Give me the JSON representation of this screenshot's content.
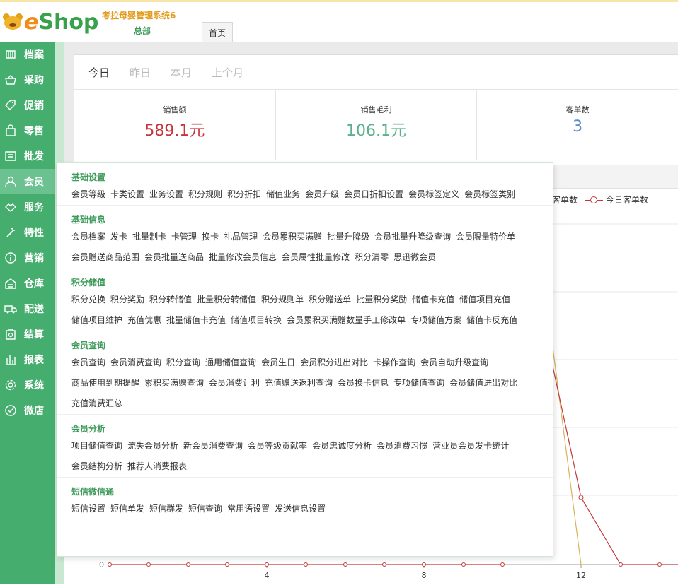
{
  "header": {
    "logo_e": "e",
    "logo_shop": "Shop",
    "system_name": "考拉母婴管理系统6",
    "branch": "总部",
    "tab_home": "首页"
  },
  "sidebar": {
    "items": [
      {
        "label": "档案",
        "icon": "archive-icon"
      },
      {
        "label": "采购",
        "icon": "basket-icon"
      },
      {
        "label": "促销",
        "icon": "tag-icon"
      },
      {
        "label": "零售",
        "icon": "shopping-bag-icon"
      },
      {
        "label": "批发",
        "icon": "wholesale-icon"
      },
      {
        "label": "会员",
        "icon": "user-icon"
      },
      {
        "label": "服务",
        "icon": "handshake-icon"
      },
      {
        "label": "特性",
        "icon": "magic-wand-icon"
      },
      {
        "label": "营销",
        "icon": "info-circle-icon"
      },
      {
        "label": "仓库",
        "icon": "warehouse-icon"
      },
      {
        "label": "配送",
        "icon": "truck-icon"
      },
      {
        "label": "结算",
        "icon": "cash-register-icon"
      },
      {
        "label": "报表",
        "icon": "bar-chart-icon"
      },
      {
        "label": "系统",
        "icon": "gear-icon"
      },
      {
        "label": "微店",
        "icon": "store-icon"
      }
    ],
    "active_index": 5
  },
  "dashboard": {
    "period_tabs": [
      "今日",
      "昨日",
      "本月",
      "上个月"
    ],
    "active_period": 0,
    "stats": [
      {
        "label": "销售额",
        "value": "589.1元",
        "color": "#c8343c"
      },
      {
        "label": "销售毛利",
        "value": "106.1元",
        "color": "#5ab08a"
      },
      {
        "label": "客单数",
        "value": "3",
        "color": "#5b8ec9"
      }
    ],
    "legend": {
      "left_label": "客单数",
      "right_label": "今日客单数"
    }
  },
  "chart_data": {
    "type": "line",
    "x_ticks": [
      "4",
      "8",
      "12"
    ],
    "y_ticks": [
      "0"
    ],
    "series": [
      {
        "name": "今日客单数",
        "color": "#c1393a"
      }
    ],
    "colors": {
      "secondary_line": "#d9b35a",
      "gridline": "#e8e8e8"
    }
  },
  "mega_menu": {
    "sections": [
      {
        "title": "基础设置",
        "items": [
          "会员等级",
          "卡类设置",
          "业务设置",
          "积分规则",
          "积分折扣",
          "储值业务",
          "会员升级",
          "会员日折扣设置",
          "会员标签定义",
          "会员标签类别"
        ]
      },
      {
        "title": "基础信息",
        "items": [
          "会员档案",
          "发卡",
          "批量制卡",
          "卡管理",
          "换卡",
          "礼品管理",
          "会员累积买满赠",
          "批量升降级",
          "会员批量升降级查询",
          "会员限量特价单",
          "会员赠送商品范围",
          "会员批量送商品",
          "批量修改会员信息",
          "会员属性批量修改",
          "积分清零",
          "思迅微会员"
        ]
      },
      {
        "title": "积分储值",
        "items": [
          "积分兑换",
          "积分奖励",
          "积分转储值",
          "批量积分转储值",
          "积分规则单",
          "积分赠送单",
          "批量积分奖励",
          "储值卡充值",
          "储值项目充值",
          "储值项目维护",
          "充值优惠",
          "批量储值卡充值",
          "储值项目转换",
          "会员累积买满赠数量手工修改单",
          "专项储值方案",
          "储值卡反充值"
        ]
      },
      {
        "title": "会员查询",
        "items": [
          "会员查询",
          "会员消费查询",
          "积分查询",
          "通用储值查询",
          "会员生日",
          "会员积分进出对比",
          "卡操作查询",
          "会员自动升级查询",
          "商品使用到期提醒",
          "累积买满赠查询",
          "会员消费让利",
          "充值赠送返利查询",
          "会员换卡信息",
          "专项储值查询",
          "会员储值进出对比",
          "充值消费汇总"
        ]
      },
      {
        "title": "会员分析",
        "items": [
          "项目储值查询",
          "流失会员分析",
          "新会员消费查询",
          "会员等级贡献率",
          "会员忠诚度分析",
          "会员消费习惯",
          "营业员会员发卡统计",
          "会员结构分析",
          "推荐人消费报表"
        ]
      },
      {
        "title": "短信微信通",
        "items": [
          "短信设置",
          "短信单发",
          "短信群发",
          "短信查询",
          "常用语设置",
          "发送信息设置"
        ]
      }
    ]
  }
}
